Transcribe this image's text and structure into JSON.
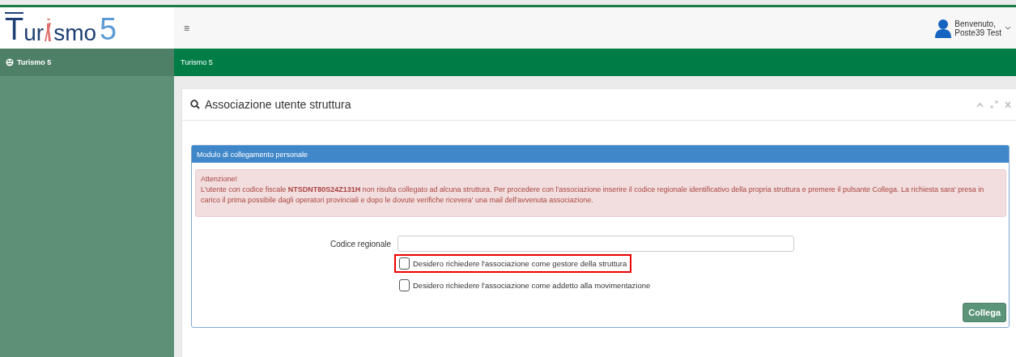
{
  "logo": {
    "parts": [
      "T",
      "ur",
      "smo",
      "5"
    ]
  },
  "header": {
    "menu_glyph": "≡",
    "greeting": "Benvenuto,",
    "user": "Poste39 Test"
  },
  "sidebar": {
    "items": [
      {
        "label": "Turismo 5",
        "selected": true
      }
    ]
  },
  "breadcrumb": "Turismo 5",
  "panel": {
    "title": "Associazione utente struttura",
    "form": {
      "title": "Modulo di collegamento personale",
      "alert": {
        "title": "Attenzione!",
        "text": "L'utente con codice fiscale **NTSDNT80S24Z131H** non risulta collegato ad alcuna struttura. Per procedere con l'associazione inserire il codice regionale identificativo della propria struttura e premere il pulsante Collega. La richiesta sara' presa in carico il prima possibile dagli operatori provinciali e dopo le dovute verifiche ricevera' una mail dell'avvenuta associazione."
      },
      "field": {
        "label": "Codice regionale"
      },
      "options": [
        {
          "label": "Desidero richiedere l'associazione come gestore della struttura",
          "checked": false,
          "highlighted": true
        },
        {
          "label": "Desidero richiedere l'associazione come addetto alla movimentazione",
          "checked": false,
          "highlighted": false
        }
      ],
      "button": "Collega"
    }
  }
}
